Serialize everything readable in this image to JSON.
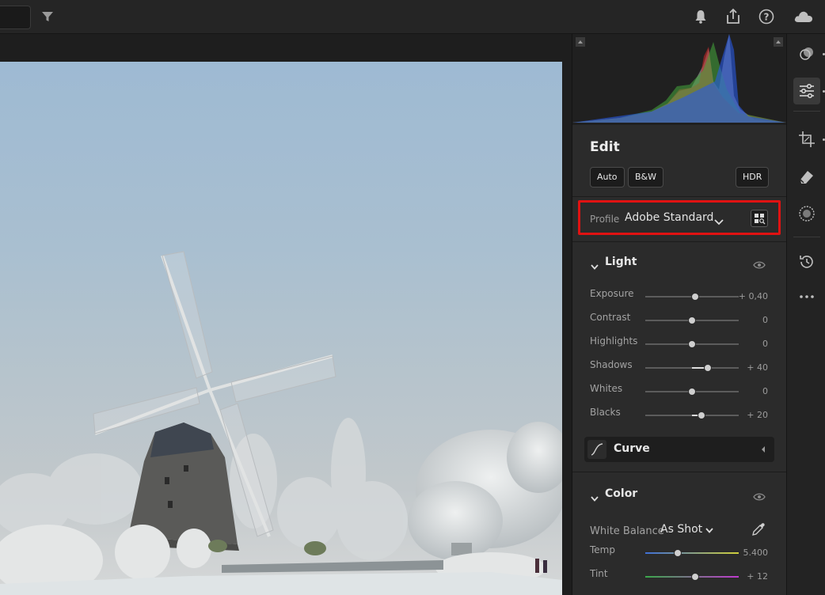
{
  "colors": {
    "panel_bg": "#2b2b2b",
    "highlight_border": "#e01212",
    "text_primary": "#e6e6e6",
    "text_muted": "#a3a3a3"
  },
  "topbar": {
    "icons": [
      "filter-icon",
      "bell-icon",
      "share-icon",
      "help-icon",
      "cloud-icon"
    ]
  },
  "edit": {
    "title": "Edit",
    "buttons": {
      "auto": "Auto",
      "bw": "B&W",
      "hdr": "HDR"
    }
  },
  "profile": {
    "label": "Profile",
    "value": "Adobe Standard"
  },
  "light": {
    "title": "Light",
    "sliders": [
      {
        "label": "Exposure",
        "value": "+ 0,40",
        "position": 0.53
      },
      {
        "label": "Contrast",
        "value": "0",
        "position": 0.5
      },
      {
        "label": "Highlights",
        "value": "0",
        "position": 0.5
      },
      {
        "label": "Shadows",
        "value": "+ 40",
        "position": 0.67
      },
      {
        "label": "Whites",
        "value": "0",
        "position": 0.5
      },
      {
        "label": "Blacks",
        "value": "+ 20",
        "position": 0.6
      }
    ]
  },
  "curve": {
    "title": "Curve"
  },
  "color": {
    "title": "Color",
    "white_balance_label": "White Balance",
    "white_balance_value": "As Shot",
    "sliders": [
      {
        "label": "Temp",
        "value": "5.400",
        "position": 0.35
      },
      {
        "label": "Tint",
        "value": "+ 12",
        "position": 0.53
      }
    ]
  },
  "tools": [
    "presets-icon",
    "edit-sliders-icon",
    "crop-icon",
    "healing-icon",
    "masking-icon",
    "history-icon",
    "more-icon"
  ]
}
